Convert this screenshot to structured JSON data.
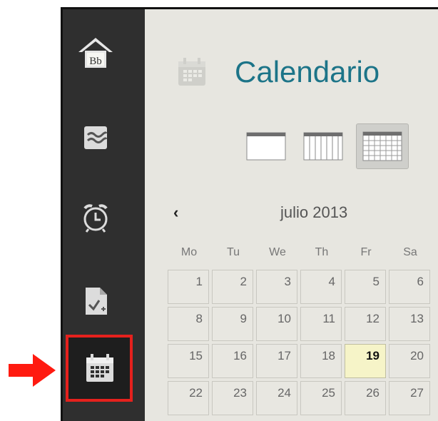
{
  "sidebar": {
    "items": [
      {
        "name": "home",
        "icon": "home-bb-icon",
        "logo_text": "Bb"
      },
      {
        "name": "streams",
        "icon": "wave-icon"
      },
      {
        "name": "due-dates",
        "icon": "alarm-clock-icon"
      },
      {
        "name": "grades",
        "icon": "document-check-icon"
      },
      {
        "name": "calendar",
        "icon": "calendar-icon",
        "active": true
      }
    ]
  },
  "main": {
    "title": "Calendario",
    "views": [
      {
        "name": "day",
        "selected": false
      },
      {
        "name": "week",
        "selected": false
      },
      {
        "name": "month",
        "selected": true
      }
    ],
    "month_label": "julio 2013",
    "prev_label": "‹",
    "weekdays": [
      "Mo",
      "Tu",
      "We",
      "Th",
      "Fr",
      "Sa"
    ],
    "weeks": [
      [
        "1",
        "2",
        "3",
        "4",
        "5",
        "6"
      ],
      [
        "8",
        "9",
        "10",
        "11",
        "12",
        "13"
      ],
      [
        "15",
        "16",
        "17",
        "18",
        "19",
        "20"
      ],
      [
        "22",
        "23",
        "24",
        "25",
        "26",
        "27"
      ]
    ],
    "today": "19"
  },
  "colors": {
    "sidebar_bg": "#2f2f2f",
    "highlight": "#e5211d",
    "title": "#1c7488",
    "today_bg": "#f6f4c8"
  }
}
